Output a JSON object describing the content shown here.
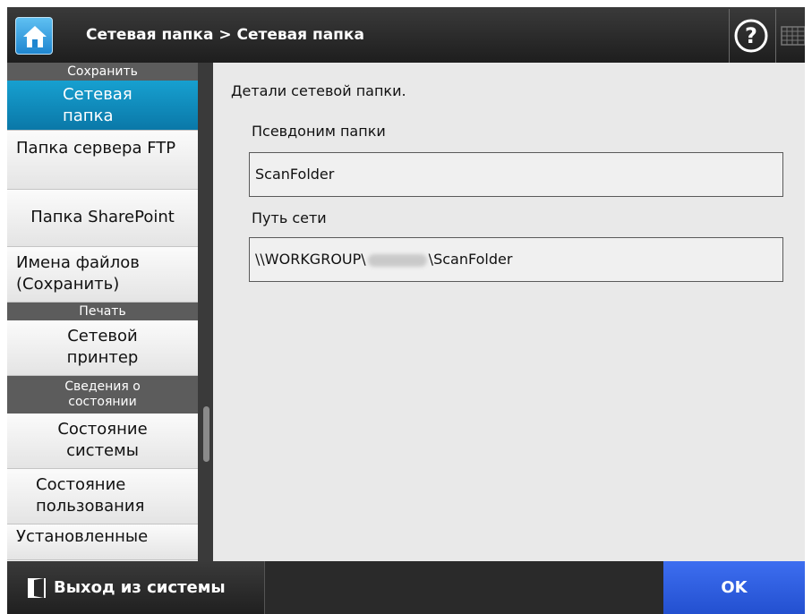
{
  "header": {
    "breadcrumb": "Сетевая папка > Сетевая папка",
    "home_icon": "home-icon",
    "help_icon": "help-icon",
    "keyboard_icon": "keyboard-icon"
  },
  "sidebar": {
    "section_save": "Сохранить",
    "item_network_folder": "Сетевая папка",
    "item_ftp": "Папка сервера FTP",
    "item_sharepoint": "Папка SharePoint",
    "item_filenames": "Имена файлов (Сохранить)",
    "section_print": "Печать",
    "item_network_printer": "Сетевой принтер",
    "section_status": "Сведения о состоянии",
    "item_system_status": "Состояние системы",
    "item_usage_status": "Состояние пользования",
    "item_installed": "Установленные"
  },
  "main": {
    "intro": "Детали сетевой папки.",
    "alias_label": "Псевдоним папки",
    "alias_value": "ScanFolder",
    "path_label": "Путь сети",
    "path_prefix": "\\\\WORKGROUP\\",
    "path_suffix": "\\ScanFolder"
  },
  "footer": {
    "logout_label": "Выход из системы",
    "ok_label": "OK"
  },
  "colors": {
    "active_item": "#0a8cc0",
    "ok_button": "#2f5fe0",
    "header_bg": "#2a2a2a",
    "content_bg": "#e9e9e9"
  }
}
